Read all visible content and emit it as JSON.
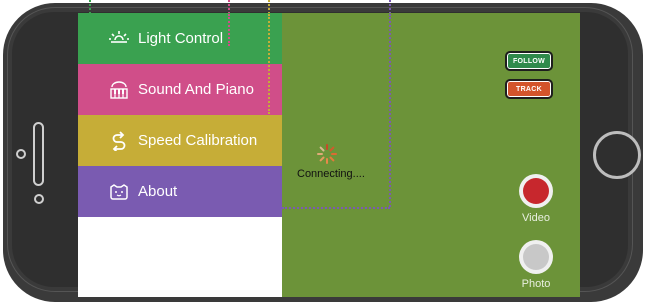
{
  "menu": {
    "items": [
      {
        "label": "Light Control",
        "icon": "light-bulb-icon",
        "color": "#3aa150"
      },
      {
        "label": "Sound And Piano",
        "icon": "piano-icon",
        "color": "#d04e89"
      },
      {
        "label": "Speed Calibration",
        "icon": "speed-calibration-icon",
        "color": "#c6ad37"
      },
      {
        "label": "About",
        "icon": "about-face-icon",
        "color": "#7a5bb1"
      }
    ]
  },
  "status": {
    "text": "Connecting...."
  },
  "controls": {
    "follow_label": "FOLLOW",
    "track_label": "TRACK",
    "video_label": "Video",
    "photo_label": "Photo"
  },
  "colors": {
    "screen_bg": "#6c9339",
    "record": "#c7272d",
    "phone_body": "#3a3a3a"
  }
}
